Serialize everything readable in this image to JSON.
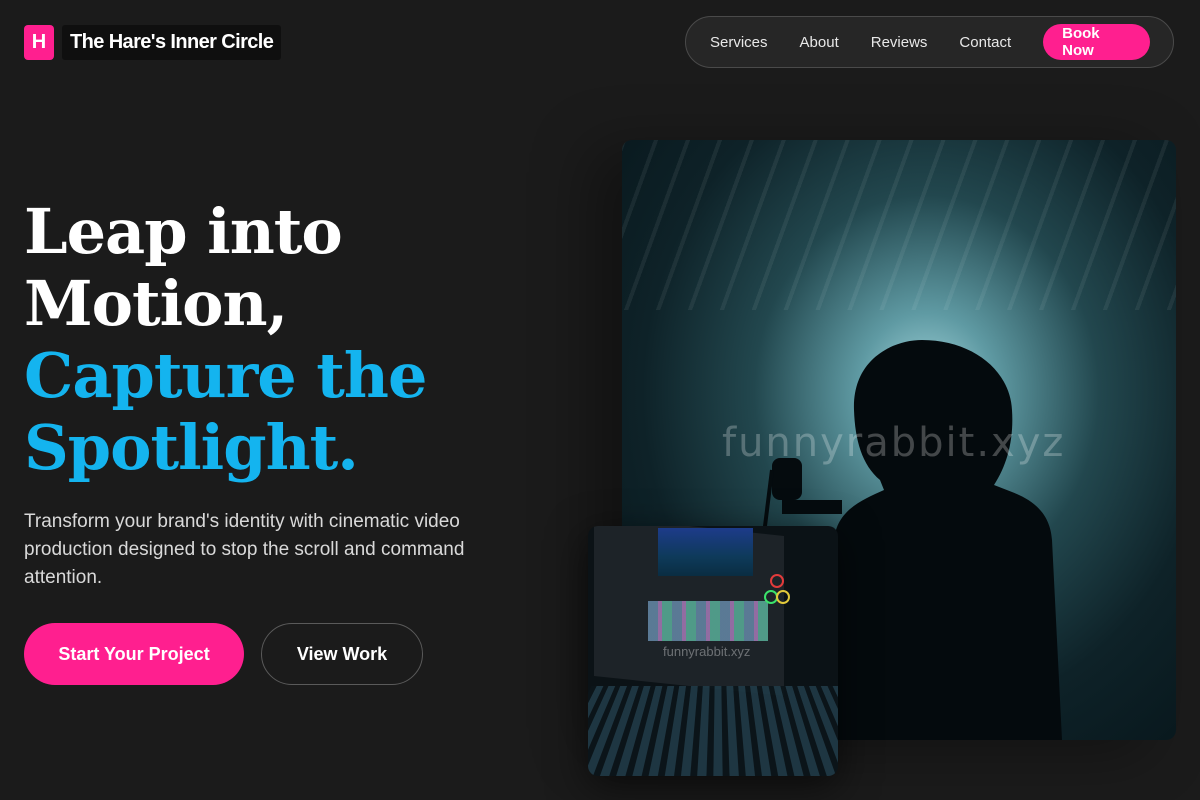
{
  "brand": {
    "mark": "H",
    "name": "The Hare's Inner Circle"
  },
  "nav": {
    "links": [
      "Services",
      "About",
      "Reviews",
      "Contact"
    ],
    "cta": "Book Now"
  },
  "hero": {
    "headline_line1": "Leap into",
    "headline_line2": "Motion,",
    "headline_line3": "Capture the",
    "headline_line4": "Spotlight.",
    "description": "Transform your brand's identity with cinematic video production designed to stop the scroll and command attention.",
    "primary_button": "Start Your Project",
    "secondary_button": "View Work"
  },
  "images": {
    "main_watermark": "funnyrabbit.xyz",
    "inset_watermark": "funnyrabbit.xyz"
  },
  "colors": {
    "accent_pink": "#ff1f8f",
    "accent_blue": "#14b4ef",
    "background": "#1b1b1b"
  }
}
